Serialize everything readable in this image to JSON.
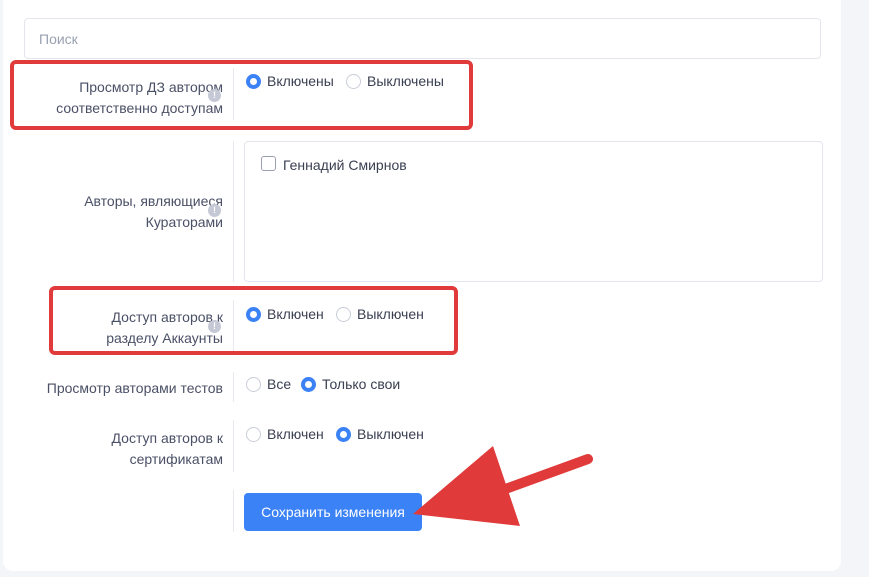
{
  "search": {
    "placeholder": "Поиск",
    "value": ""
  },
  "settings": [
    {
      "label_lines": [
        "Просмотр ДЗ автором",
        "соответственно доступам"
      ],
      "options": [
        {
          "label": "Включены",
          "selected": true
        },
        {
          "label": "Выключены",
          "selected": false
        }
      ]
    },
    {
      "label_lines": [
        "Авторы, являющиеся",
        "Кураторами"
      ],
      "checkboxes": [
        {
          "label": "Геннадий Смирнов",
          "checked": false
        }
      ]
    },
    {
      "label_lines": [
        "Доступ авторов к",
        "разделу Аккаунты"
      ],
      "options": [
        {
          "label": "Включен",
          "selected": true
        },
        {
          "label": "Выключен",
          "selected": false
        }
      ]
    },
    {
      "label_lines": [
        "Просмотр авторами тестов"
      ],
      "options": [
        {
          "label": "Все",
          "selected": false
        },
        {
          "label": "Только свои",
          "selected": true
        }
      ]
    },
    {
      "label_lines": [
        "Доступ авторов к",
        "сертификатам"
      ],
      "options": [
        {
          "label": "Включен",
          "selected": false
        },
        {
          "label": "Выключен",
          "selected": true
        }
      ]
    }
  ],
  "info_icon_glyph": "!",
  "save_button": {
    "label": "Сохранить изменения"
  },
  "colors": {
    "accent": "#3b82f6",
    "highlight": "#e03a3a"
  }
}
